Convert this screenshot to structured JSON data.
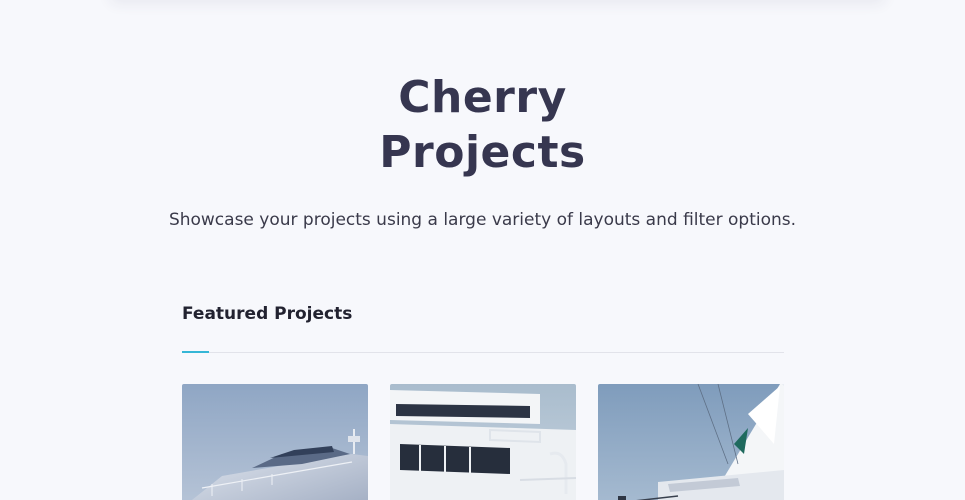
{
  "hero": {
    "title_line1": "Cherry",
    "title_line2": "Projects",
    "subtitle": "Showcase your projects using a large variety of layouts and filter options."
  },
  "featured": {
    "heading": "Featured Projects",
    "accent_color": "#35b6d6"
  },
  "projects": [
    {
      "image": "motor-yacht-photo"
    },
    {
      "image": "yacht-deck-photo"
    },
    {
      "image": "sailboat-photo"
    }
  ],
  "colors": {
    "background": "#f7f8fc",
    "title": "#363650",
    "text": "#3a3a4a"
  }
}
